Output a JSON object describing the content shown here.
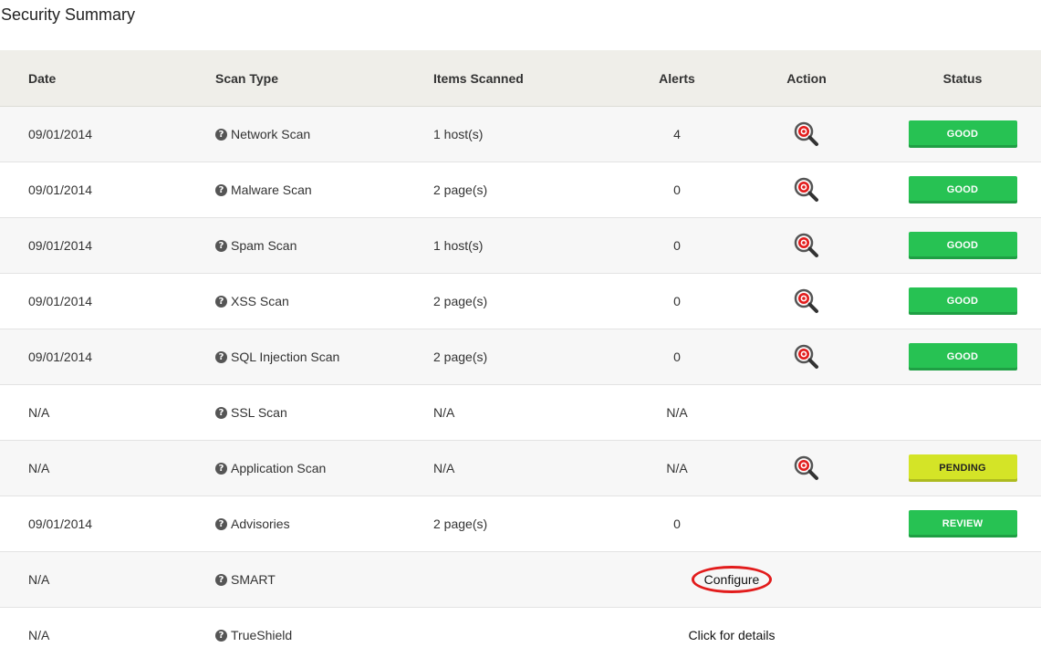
{
  "page_title": "Security Summary",
  "columns": {
    "date": "Date",
    "scan_type": "Scan Type",
    "items": "Items Scanned",
    "alerts": "Alerts",
    "action": "Action",
    "status": "Status"
  },
  "rows": [
    {
      "date": "09/01/2014",
      "type": "Network Scan",
      "items": "1 host(s)",
      "alerts": "4",
      "status": "GOOD"
    },
    {
      "date": "09/01/2014",
      "type": "Malware Scan",
      "items": "2 page(s)",
      "alerts": "0",
      "status": "GOOD"
    },
    {
      "date": "09/01/2014",
      "type": "Spam Scan",
      "items": "1 host(s)",
      "alerts": "0",
      "status": "GOOD"
    },
    {
      "date": "09/01/2014",
      "type": "XSS Scan",
      "items": "2 page(s)",
      "alerts": "0",
      "status": "GOOD"
    },
    {
      "date": "09/01/2014",
      "type": "SQL Injection Scan",
      "items": "2 page(s)",
      "alerts": "0",
      "status": "GOOD"
    },
    {
      "date": "N/A",
      "type": "SSL Scan",
      "items": "N/A",
      "alerts": "N/A"
    },
    {
      "date": "N/A",
      "type": "Application Scan",
      "items": "N/A",
      "alerts": "N/A",
      "status": "PENDING"
    },
    {
      "date": "09/01/2014",
      "type": "Advisories",
      "items": "2 page(s)",
      "alerts": "0",
      "status": "REVIEW"
    },
    {
      "date": "N/A",
      "type": "SMART",
      "link": "Configure"
    },
    {
      "date": "N/A",
      "type": "TrueShield",
      "link": "Click for details"
    }
  ],
  "help_glyph": "?",
  "icons": {
    "help": "question-circle-icon",
    "action": "magnifier-target-icon"
  },
  "colors": {
    "good": "#27c253",
    "pending": "#d4e427",
    "review": "#27c253",
    "header_bg": "#efeee9",
    "highlight_ring": "#e21c1c"
  }
}
